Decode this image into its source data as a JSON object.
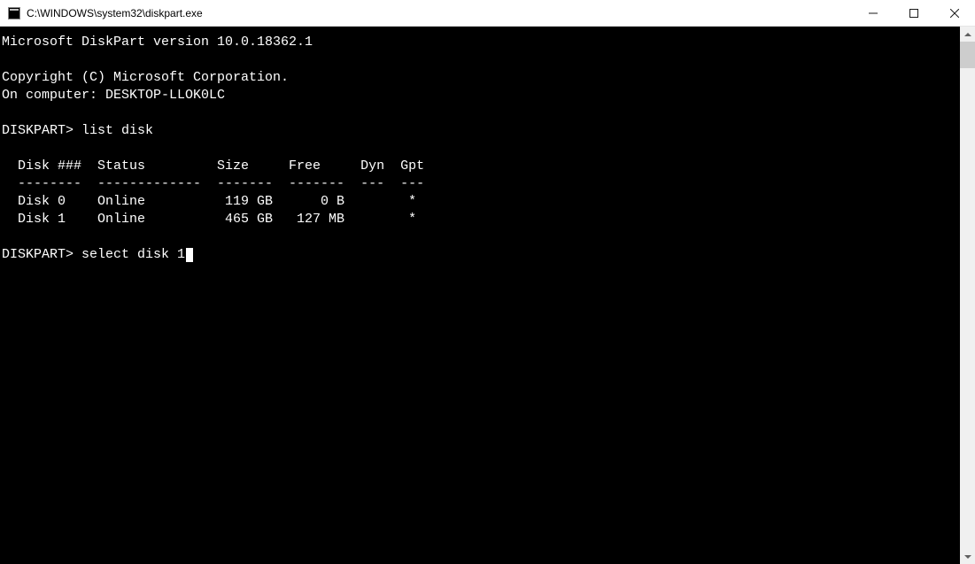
{
  "titlebar": {
    "title": "C:\\WINDOWS\\system32\\diskpart.exe"
  },
  "console": {
    "version_line": "Microsoft DiskPart version 10.0.18362.1",
    "copyright_line": "Copyright (C) Microsoft Corporation.",
    "computer_line": "On computer: DESKTOP-LLOK0LC",
    "prompt1": "DISKPART>",
    "command1": "list disk",
    "table_header": "  Disk ###  Status         Size     Free     Dyn  Gpt",
    "table_divider": "  --------  -------------  -------  -------  ---  ---",
    "row0": "  Disk 0    Online          119 GB      0 B        *",
    "row1": "  Disk 1    Online          465 GB   127 MB        *",
    "prompt2": "DISKPART>",
    "command2": "select disk 1",
    "disks": [
      {
        "id": "Disk 0",
        "status": "Online",
        "size": "119 GB",
        "free": "0 B",
        "dyn": "",
        "gpt": "*"
      },
      {
        "id": "Disk 1",
        "status": "Online",
        "size": "465 GB",
        "free": "127 MB",
        "dyn": "",
        "gpt": "*"
      }
    ]
  }
}
